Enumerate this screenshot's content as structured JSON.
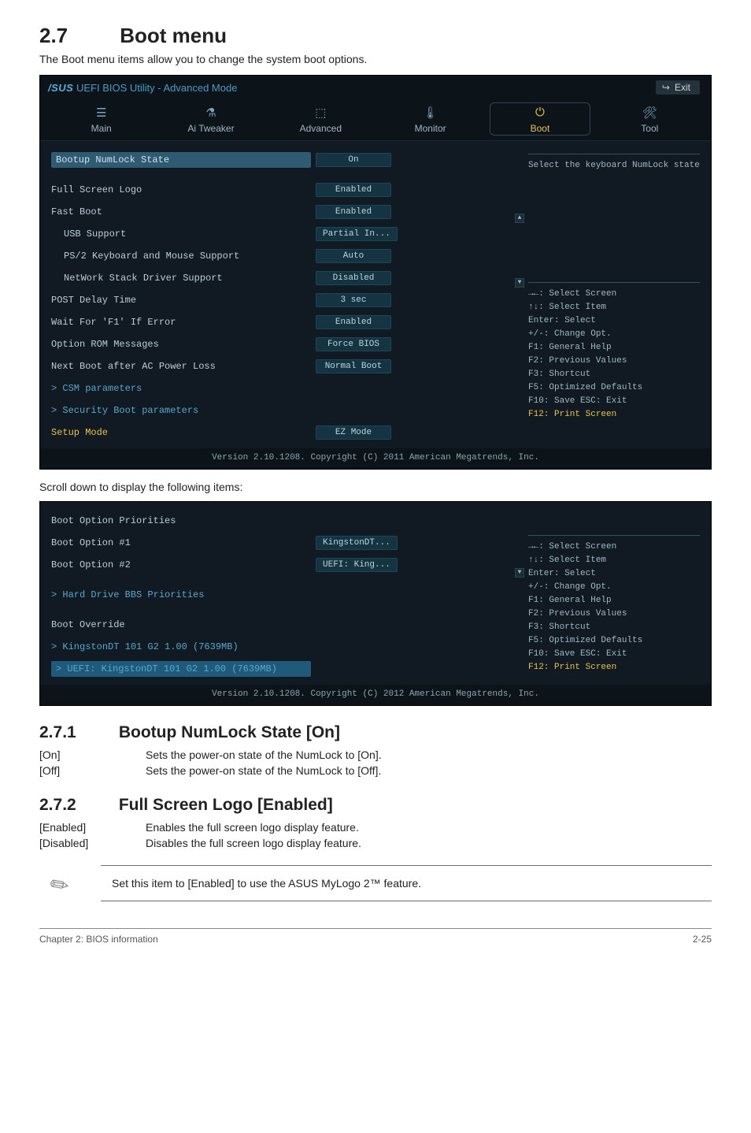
{
  "section": {
    "number": "2.7",
    "title": "Boot menu"
  },
  "intro": "The Boot menu items allow you to change the system boot options.",
  "bios1": {
    "brand": "/SUS",
    "title": "UEFI BIOS Utility - Advanced Mode",
    "exit": "Exit",
    "nav": [
      {
        "icon": "☰",
        "label": "Main"
      },
      {
        "icon": "⚗",
        "label": "Ai Tweaker"
      },
      {
        "icon": "⬚",
        "label": "Advanced"
      },
      {
        "icon": "🌡",
        "label": "Monitor"
      },
      {
        "icon": "⏻",
        "label": "Boot",
        "active": true
      },
      {
        "icon": "🛠",
        "label": "Tool"
      }
    ],
    "help": "Select the keyboard NumLock state",
    "options": [
      {
        "label": "Bootup NumLock State",
        "value": "On",
        "highlight": true
      },
      {
        "label": "Full Screen Logo",
        "value": "Enabled",
        "spacer": true
      },
      {
        "label": "Fast Boot",
        "value": "Enabled"
      },
      {
        "label": "USB Support",
        "value": "Partial In...",
        "indent": true
      },
      {
        "label": "PS/2 Keyboard and Mouse Support",
        "value": "Auto",
        "indent": true
      },
      {
        "label": "NetWork Stack Driver Support",
        "value": "Disabled",
        "indent": true
      },
      {
        "label": "POST Delay Time",
        "value": "3 sec"
      },
      {
        "label": "Wait For 'F1' If Error",
        "value": "Enabled"
      },
      {
        "label": "Option ROM Messages",
        "value": "Force BIOS"
      },
      {
        "label": "Next Boot after AC Power Loss",
        "value": "Normal Boot"
      },
      {
        "label": "CSM parameters",
        "link": true
      },
      {
        "label": "Security Boot parameters",
        "link": true
      },
      {
        "label": "Setup Mode",
        "value": "EZ Mode",
        "yellow": true
      }
    ],
    "keys": [
      "→←: Select Screen",
      "↑↓: Select Item",
      "Enter: Select",
      "+/-: Change Opt.",
      "F1: General Help",
      "F2: Previous Values",
      "F3: Shortcut",
      "F5: Optimized Defaults",
      "F10: Save  ESC: Exit"
    ],
    "print_key": "F12: Print Screen",
    "footer": "Version 2.10.1208. Copyright (C) 2011 American Megatrends, Inc."
  },
  "scroll_caption": "Scroll down to display the following items:",
  "bios2": {
    "options": [
      {
        "label": "Boot Option Priorities",
        "static": true
      },
      {
        "label": "Boot Option #1",
        "value": "KingstonDT..."
      },
      {
        "label": "Boot Option #2",
        "value": "UEFI: King..."
      },
      {
        "label": "Hard Drive BBS Priorities",
        "link": true,
        "spacer": true
      },
      {
        "label": "Boot Override",
        "static": true,
        "spacer": true
      },
      {
        "label": "KingstonDT 101 G2 1.00  (7639MB)",
        "link": true
      },
      {
        "label": "UEFI: KingstonDT 101 G2 1.00 (7639MB)",
        "link": true,
        "highlight_blue": true
      }
    ],
    "keys": [
      "→←: Select Screen",
      "↑↓: Select Item",
      "Enter: Select",
      "+/-: Change Opt.",
      "F1: General Help",
      "F2: Previous Values",
      "F3: Shortcut",
      "F5: Optimized Defaults",
      "F10: Save  ESC: Exit"
    ],
    "print_key": "F12: Print Screen",
    "footer": "Version 2.10.1208. Copyright (C) 2012 American Megatrends, Inc."
  },
  "sub1": {
    "number": "2.7.1",
    "title": "Bootup NumLock State [On]",
    "rows": [
      {
        "k": "[On]",
        "v": "Sets the power-on state of the NumLock to [On]."
      },
      {
        "k": "[Off]",
        "v": "Sets the power-on state of the NumLock to [Off]."
      }
    ]
  },
  "sub2": {
    "number": "2.7.2",
    "title": "Full Screen Logo [Enabled]",
    "rows": [
      {
        "k": "[Enabled]",
        "v": "Enables the full screen logo display feature."
      },
      {
        "k": "[Disabled]",
        "v": "Disables the full screen logo display feature."
      }
    ]
  },
  "note": "Set this item to [Enabled] to use the ASUS MyLogo 2™ feature.",
  "page_footer": {
    "left": "Chapter 2: BIOS information",
    "right": "2-25"
  }
}
